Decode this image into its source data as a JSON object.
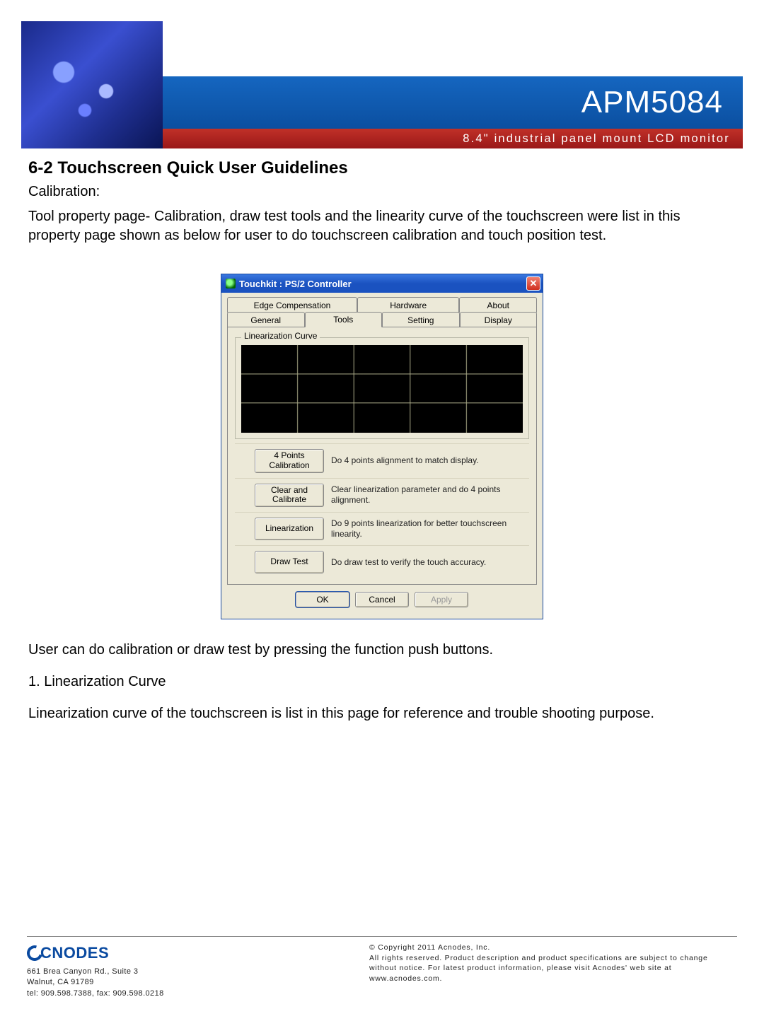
{
  "header": {
    "model": "APM5084",
    "subtitle": "8.4\" industrial panel mount LCD monitor"
  },
  "section": {
    "title": "6-2  Touchscreen Quick User Guidelines",
    "sub": "Calibration:",
    "intro": "Tool property page- Calibration, draw test tools and the linearity curve of the touchscreen were list in this property page shown as below for user to do touchscreen calibration and touch position test.",
    "after1": "User can do calibration or draw test by pressing the function push buttons.",
    "after2_title": "1. Linearization Curve",
    "after2_body": "Linearization curve of the touchscreen is list in this page for reference and trouble shooting purpose."
  },
  "dialog": {
    "title": "Touchkit : PS/2 Controller",
    "tabs_row1": [
      "Edge Compensation",
      "Hardware",
      "About"
    ],
    "tabs_row2": [
      "General",
      "Tools",
      "Setting",
      "Display"
    ],
    "active_tab": "Tools",
    "group_label": "Linearization Curve",
    "actions": [
      {
        "button": "4 Points Calibration",
        "text": "Do 4 points alignment to match display."
      },
      {
        "button": "Clear and Calibrate",
        "text": "Clear linearization parameter and do 4 points alignment."
      },
      {
        "button": "Linearization",
        "text": "Do 9 points linearization for better touchscreen linearity."
      },
      {
        "button": "Draw Test",
        "text": "Do draw test to verify the touch accuracy."
      }
    ],
    "buttons": {
      "ok": "OK",
      "cancel": "Cancel",
      "apply": "Apply"
    }
  },
  "footer": {
    "brand": "CNODES",
    "address1": "661 Brea Canyon Rd., Suite 3",
    "address2": "Walnut, CA 91789",
    "contact": "tel: 909.598.7388, fax: 909.598.0218",
    "legal": "© Copyright 2011 Acnodes, Inc.\nAll rights reserved. Product description and product specifications are subject to change without notice. For latest product information, please visit Acnodes' web site at www.acnodes.com."
  }
}
